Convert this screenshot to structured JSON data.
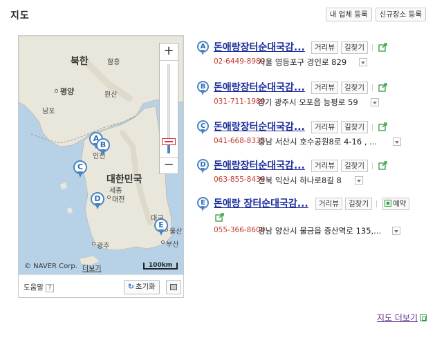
{
  "header": {
    "title": "지도",
    "my_business_btn": "내 업체 등록",
    "new_place_btn": "신규장소 등록"
  },
  "map": {
    "labels": {
      "north_korea": "북한",
      "hamheung": "함흥",
      "pyongyang": "평양",
      "wonsan": "원산",
      "nampo": "남포",
      "south_korea": "대한민국",
      "sejong": "세종",
      "daejeon": "대전",
      "daegu": "대구",
      "ulsan": "울산",
      "busan": "부산",
      "gwangju": "광주",
      "incheon": "인천"
    },
    "pins": [
      "A",
      "B",
      "C",
      "D",
      "E"
    ],
    "copyright": "© NAVER Corp.",
    "more_short": "더보기",
    "scale": "100km",
    "zoom_in": "+",
    "zoom_out": "−",
    "help": "도움말",
    "help_q": "?",
    "reset": "초기화"
  },
  "results": [
    {
      "marker": "A",
      "name": "돈애랑장터순대국감...",
      "btn_view": "거리뷰",
      "btn_route": "길찾기",
      "phone": "02-6449-8989",
      "address": "서울 영등포구 경인로 829"
    },
    {
      "marker": "B",
      "name": "돈애랑장터순대국감...",
      "btn_view": "거리뷰",
      "btn_route": "길찾기",
      "phone": "031-711-1980",
      "address": "경기 광주시 오포읍 능평로 59"
    },
    {
      "marker": "C",
      "name": "돈애랑장터순대국감...",
      "btn_view": "거리뷰",
      "btn_route": "길찾기",
      "phone": "041-668-8333",
      "address": "충남 서산시 호수공원8로 4-16 , ..."
    },
    {
      "marker": "D",
      "name": "돈애랑장터순대국감...",
      "btn_view": "거리뷰",
      "btn_route": "길찾기",
      "phone": "063-855-8439",
      "address": "전북 익산시 하나로8길 8"
    },
    {
      "marker": "E",
      "name": "돈애랑 장터순대국감...",
      "btn_view": "거리뷰",
      "btn_route": "길찾기",
      "btn_reserve": "예약",
      "phone": "055-366-8600",
      "address": "경남 양산시 물금읍 증산역로 135,..."
    }
  ],
  "footer": {
    "more_map": "지도 더보기"
  },
  "colors": {
    "link": "#1a2c9c",
    "phone": "#c0392b",
    "pin": "#4b84c4",
    "visited": "#6a2c91"
  }
}
